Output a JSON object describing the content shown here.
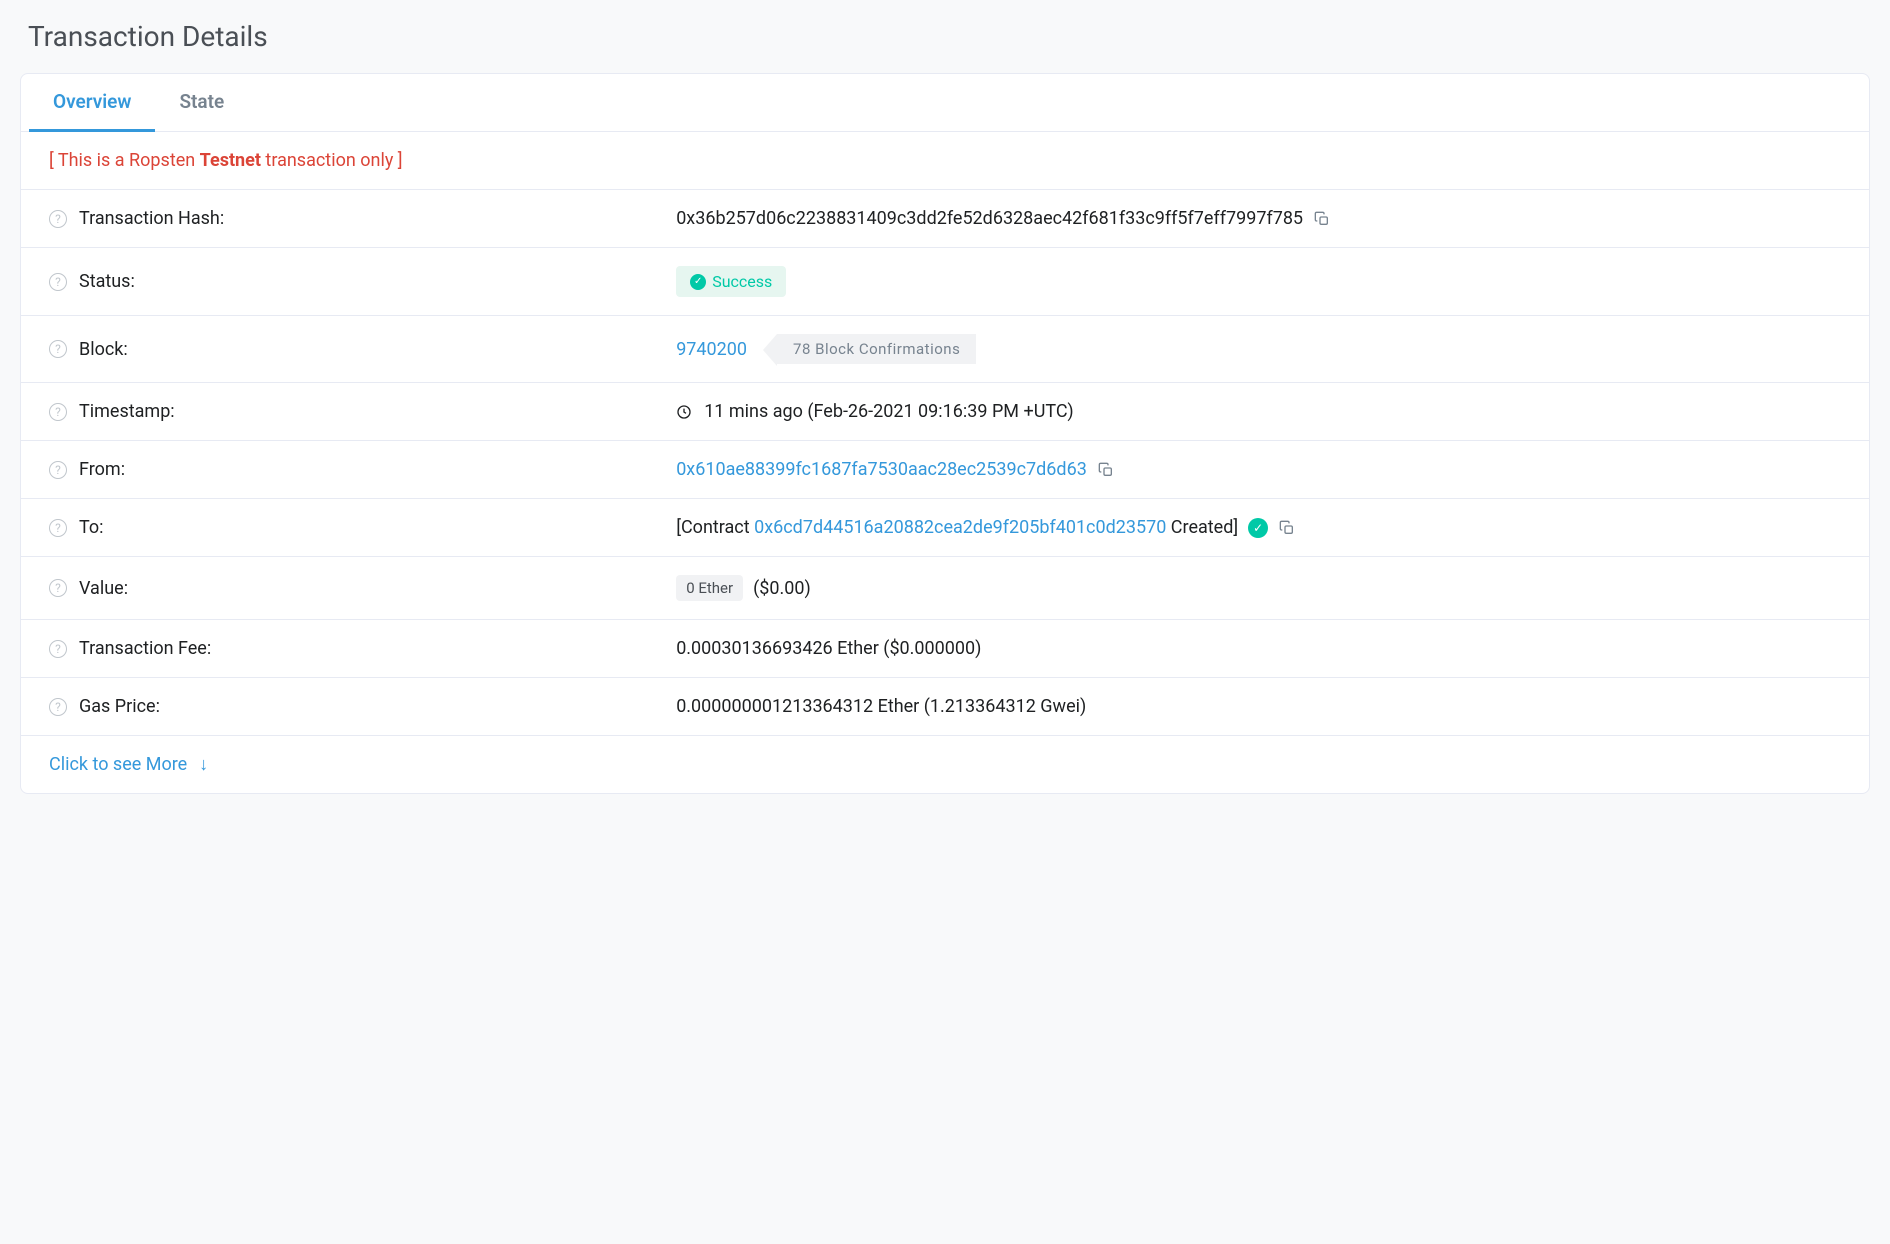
{
  "page": {
    "title": "Transaction Details"
  },
  "tabs": {
    "overview": "Overview",
    "state": "State"
  },
  "notice": {
    "prefix": "[ This is a Ropsten ",
    "bold": "Testnet",
    "suffix": " transaction only ]"
  },
  "labels": {
    "txhash": "Transaction Hash:",
    "status": "Status:",
    "block": "Block:",
    "timestamp": "Timestamp:",
    "from": "From:",
    "to": "To:",
    "value": "Value:",
    "txfee": "Transaction Fee:",
    "gasprice": "Gas Price:"
  },
  "values": {
    "txhash": "0x36b257d06c2238831409c3dd2fe52d6328aec42f681f33c9ff5f7eff7997f785",
    "status": "Success",
    "block": "9740200",
    "confirmations": "78 Block Confirmations",
    "timestamp": "11 mins ago (Feb-26-2021 09:16:39 PM +UTC)",
    "from": "0x610ae88399fc1687fa7530aac28ec2539c7d6d63",
    "to_prefix": "[Contract ",
    "to_address": "0x6cd7d44516a20882cea2de9f205bf401c0d23570",
    "to_suffix": " Created]",
    "value_badge": "0 Ether",
    "value_usd": "($0.00)",
    "txfee": "0.00030136693426 Ether ($0.000000)",
    "gasprice": "0.000000001213364312 Ether (1.213364312 Gwei)"
  },
  "seemore": {
    "text": "Click to see More"
  }
}
